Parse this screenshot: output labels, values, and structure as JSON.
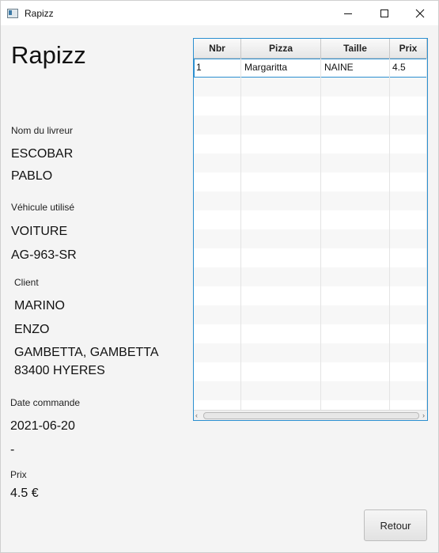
{
  "window": {
    "title": "Rapizz"
  },
  "header": {
    "title": "Rapizz"
  },
  "livreur": {
    "label": "Nom du livreur",
    "nom": "ESCOBAR",
    "prenom": "PABLO"
  },
  "vehicule": {
    "label": "Véhicule utilisé",
    "type": "VOITURE",
    "immat": "AG-963-SR"
  },
  "client": {
    "label": "Client",
    "nom": "MARINO",
    "prenom": "ENZO",
    "adresse_1": "GAMBETTA, GAMBETTA",
    "adresse_2": "83400 HYERES"
  },
  "commande": {
    "label": "Date commande",
    "date": "2021-06-20",
    "separator": "-"
  },
  "prix": {
    "label": "Prix",
    "value": "4.5 €"
  },
  "table": {
    "columns": [
      "Nbr",
      "Pizza",
      "Taille",
      "Prix"
    ],
    "rows": [
      {
        "nbr": "1",
        "pizza": "Margaritta",
        "taille": "NAINE",
        "prix": "4.5"
      }
    ]
  },
  "buttons": {
    "retour": "Retour"
  }
}
